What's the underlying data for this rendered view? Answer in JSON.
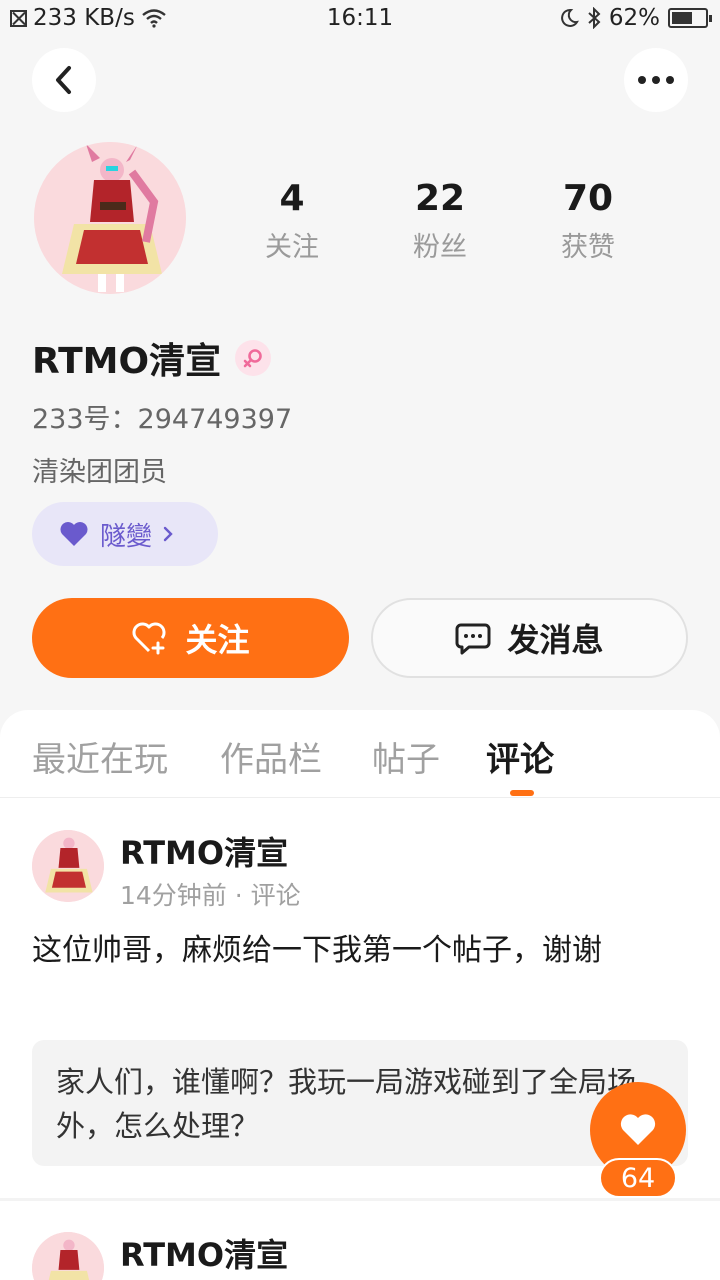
{
  "status_bar": {
    "speed": "233 KB/s",
    "time": "16:11",
    "battery": "62%",
    "battery_level": 0.62
  },
  "profile": {
    "stats": [
      {
        "value": "4",
        "label": "关注"
      },
      {
        "value": "22",
        "label": "粉丝"
      },
      {
        "value": "70",
        "label": "获赞"
      }
    ],
    "name": "RTMO清宣",
    "uid": "233号：294749397",
    "bio": "清染团团员",
    "tag": "隧變",
    "follow_label": "关注",
    "message_label": "发消息"
  },
  "tabs": [
    "最近在玩",
    "作品栏",
    "帖子",
    "评论"
  ],
  "active_tab": "评论",
  "posts": [
    {
      "author": "RTMO清宣",
      "meta": "14分钟前 · 评论",
      "body": "这位帅哥，麻烦给一下我第一个帖子，谢谢",
      "quote": "家人们，谁懂啊？我玩一局游戏碰到了全局场外，怎么处理？"
    },
    {
      "author": "RTMO清宣"
    }
  ],
  "like": {
    "count": "64"
  },
  "colors": {
    "accent": "#ff7014",
    "tag_purple": "#6a5acd"
  }
}
